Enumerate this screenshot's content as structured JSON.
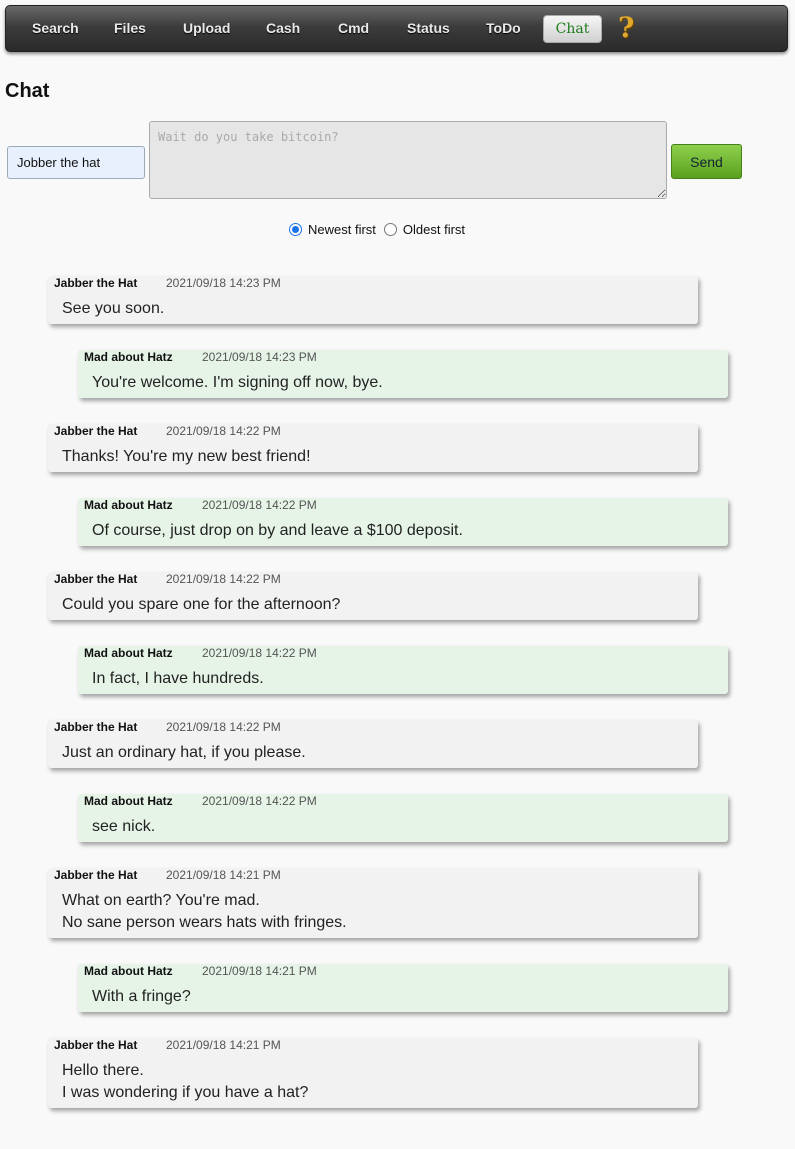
{
  "nav": {
    "items": [
      "Search",
      "Files",
      "Upload",
      "Cash",
      "Cmd",
      "Status",
      "ToDo"
    ],
    "active": "Chat",
    "help": "?"
  },
  "page_title": "Chat",
  "compose": {
    "name_value": "Jobber the hat",
    "message_placeholder": "Wait do you take bitcoin?",
    "send_label": "Send"
  },
  "sort": {
    "newest_label": "Newest first",
    "oldest_label": "Oldest first",
    "selected": "newest"
  },
  "messages": [
    {
      "author": "Jabber the Hat",
      "time": "2021/09/18 14:23 PM",
      "side": "left",
      "lines": [
        "See you soon."
      ]
    },
    {
      "author": "Mad about Hatz",
      "time": "2021/09/18 14:23 PM",
      "side": "right",
      "lines": [
        "You're welcome. I'm signing off now, bye."
      ]
    },
    {
      "author": "Jabber the Hat",
      "time": "2021/09/18 14:22 PM",
      "side": "left",
      "lines": [
        "Thanks! You're my new best friend!"
      ]
    },
    {
      "author": "Mad about Hatz",
      "time": "2021/09/18 14:22 PM",
      "side": "right",
      "lines": [
        "Of course, just drop on by and leave a $100 deposit."
      ]
    },
    {
      "author": "Jabber the Hat",
      "time": "2021/09/18 14:22 PM",
      "side": "left",
      "lines": [
        "Could you spare one for the afternoon?"
      ]
    },
    {
      "author": "Mad about Hatz",
      "time": "2021/09/18 14:22 PM",
      "side": "right",
      "lines": [
        "In fact, I have hundreds."
      ]
    },
    {
      "author": "Jabber the Hat",
      "time": "2021/09/18 14:22 PM",
      "side": "left",
      "lines": [
        "Just an ordinary hat, if you please."
      ]
    },
    {
      "author": "Mad about Hatz",
      "time": "2021/09/18 14:22 PM",
      "side": "right",
      "lines": [
        "see nick."
      ]
    },
    {
      "author": "Jabber the Hat",
      "time": "2021/09/18 14:21 PM",
      "side": "left",
      "lines": [
        "What on earth? You're mad.",
        "No sane person wears hats with fringes."
      ]
    },
    {
      "author": "Mad about Hatz",
      "time": "2021/09/18 14:21 PM",
      "side": "right",
      "lines": [
        "With a fringe?"
      ]
    },
    {
      "author": "Jabber the Hat",
      "time": "2021/09/18 14:21 PM",
      "side": "left",
      "lines": [
        "Hello there.",
        "I was wondering if you have a hat?"
      ]
    }
  ]
}
